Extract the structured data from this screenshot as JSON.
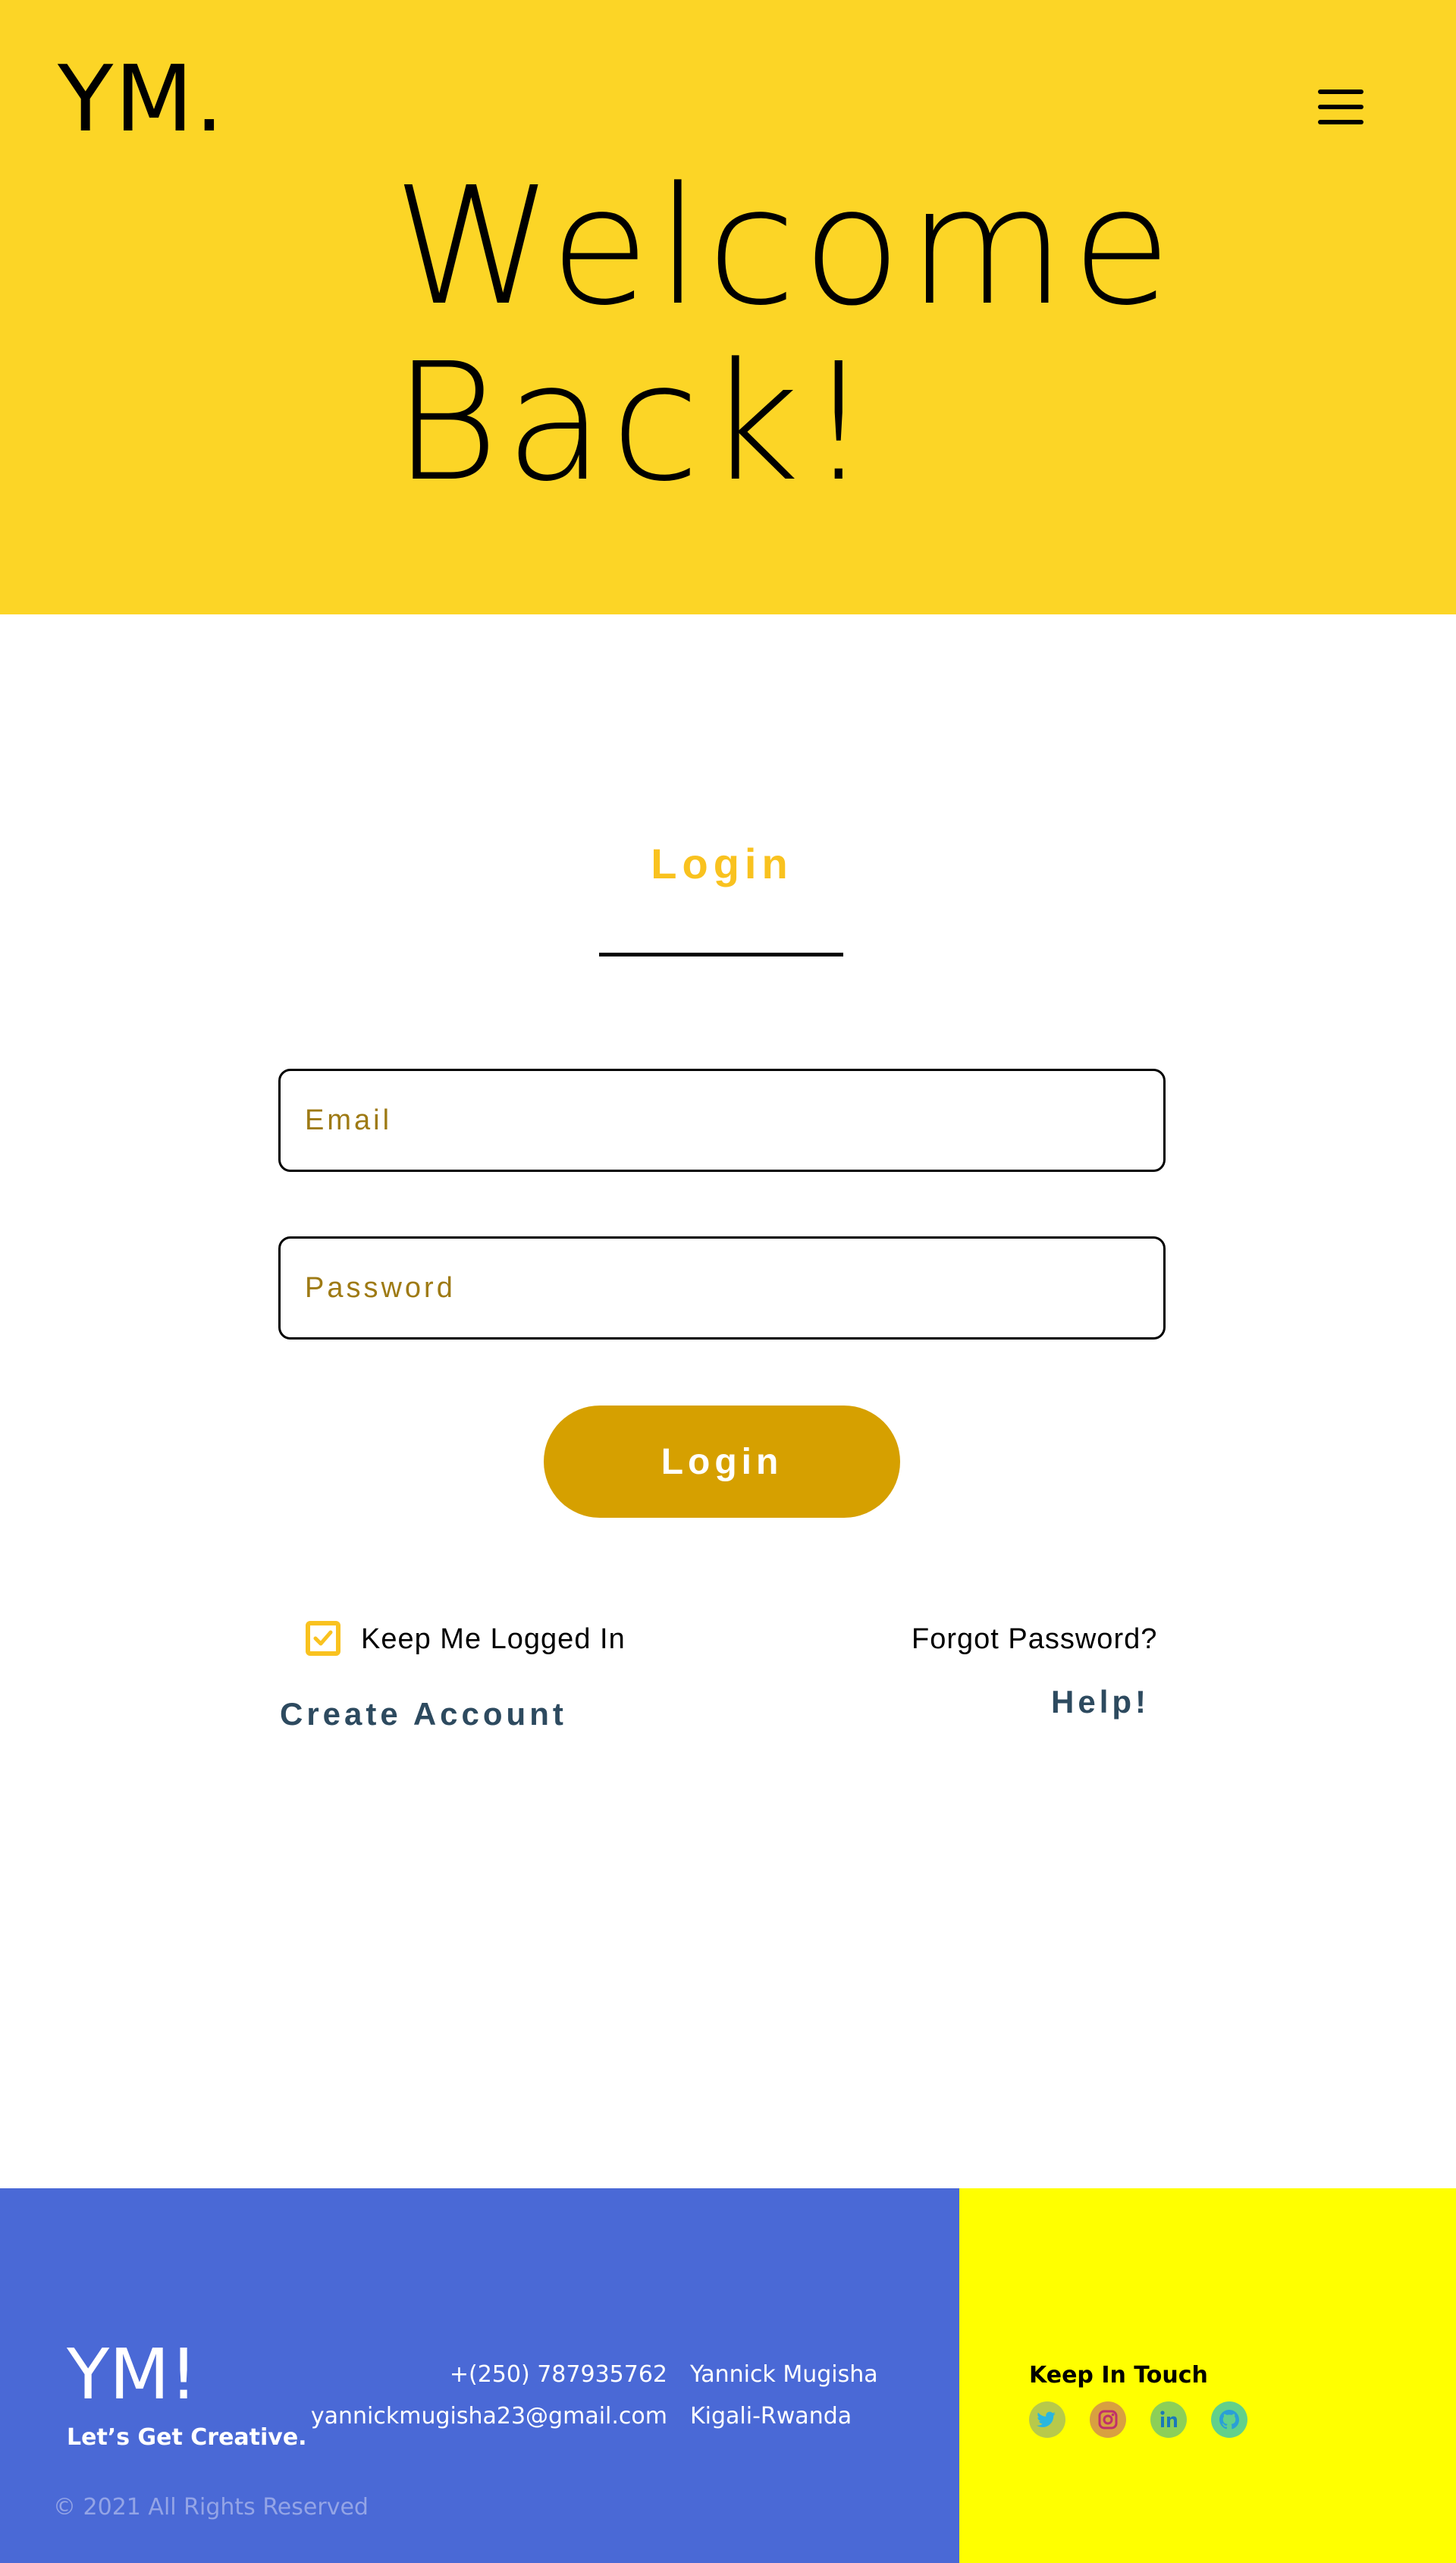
{
  "header": {
    "logo": "YM.",
    "hero_line1": "Welcome",
    "hero_line2": "Back!",
    "menu_icon": "hamburger-menu-icon"
  },
  "login_form": {
    "title": "Login",
    "email_placeholder": "Email",
    "password_placeholder": "Password",
    "submit_label": "Login",
    "keep_logged_in_label": "Keep Me Logged In",
    "keep_logged_in_checked": true,
    "forgot_password_label": "Forgot Password?",
    "create_account_label": "Create Account",
    "help_label": "Help!"
  },
  "footer": {
    "logo": "YM!",
    "tagline": "Let’s Get Creative.",
    "phone": "+(250) 787935762",
    "email": "yannickmugisha23@gmail.com",
    "name": "Yannick Mugisha",
    "location": "Kigali-Rwanda",
    "copyright": "© 2021 All Rights Reserved",
    "keep_in_touch": "Keep In Touch",
    "social_icons": [
      "twitter-icon",
      "instagram-icon",
      "linkedin-icon",
      "github-icon"
    ]
  },
  "colors": {
    "hero_bg": "#fcd526",
    "accent_yellow": "#f9c21f",
    "login_button": "#d6a000",
    "link_dark": "#2d4a5f",
    "footer_blue": "#4a69d6",
    "footer_yellow": "#ffff00"
  }
}
